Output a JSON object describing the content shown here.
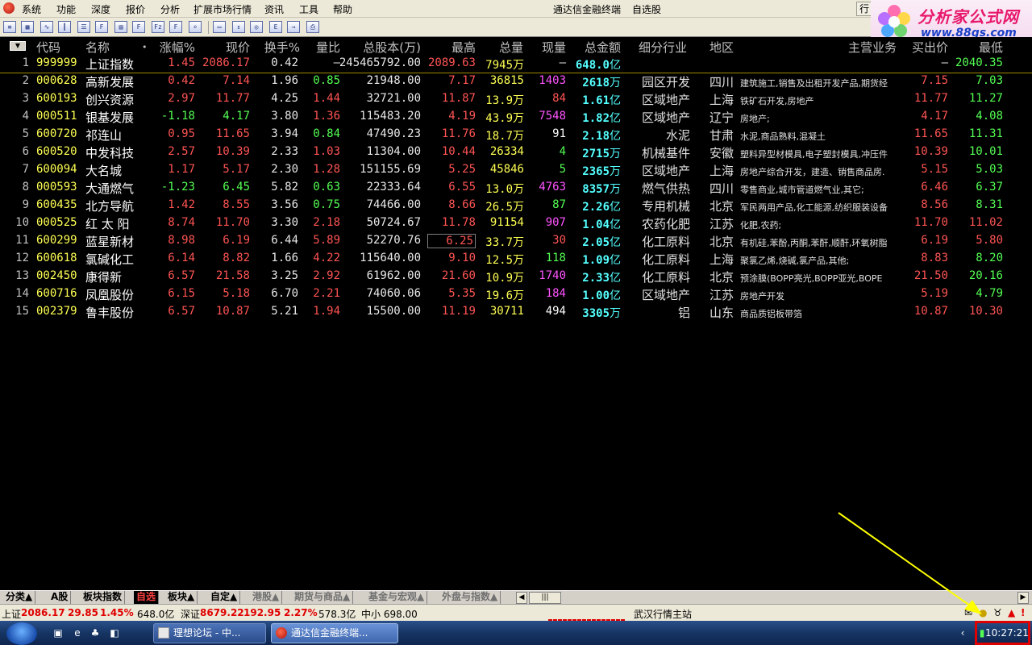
{
  "menu": {
    "items": [
      "系统",
      "功能",
      "深度",
      "报价",
      "分析",
      "扩展市场行情",
      "资讯",
      "工具",
      "帮助"
    ],
    "title": "通达信金融终端",
    "view": "自选股",
    "quote_btn": "行"
  },
  "logo": {
    "brand": "分析家公式网",
    "url": "www.88gs.com"
  },
  "toolbar": {
    "icons": [
      "list-icon",
      "grid-icon",
      "line-chart-icon",
      "candle-icon",
      "report-icon",
      "fio-icon",
      "doc-icon",
      "f10-icon",
      "fiz-icon",
      "f-icon",
      "zoom-icon",
      "folder-icon",
      "sort-icon",
      "filter-icon",
      "eft-icon",
      "export-icon",
      "print-icon"
    ]
  },
  "columns": {
    "code": "代码",
    "name": "名称",
    "dot": "•",
    "change_pct": "涨幅%",
    "price": "现价",
    "turnover": "换手%",
    "volume_ratio": "量比",
    "total_shares": "总股本(万)",
    "high": "最高",
    "total_vol": "总量",
    "cur_vol": "现量",
    "amount": "总金额",
    "industry": "细分行业",
    "region": "地区",
    "business": "主营业务",
    "bid": "买出价",
    "low": "最低"
  },
  "rows": [
    {
      "idx": "1",
      "code": "999999",
      "name": "上证指数",
      "chg": "1.45",
      "price": "2086.17",
      "turn": "0.42",
      "vr": "—",
      "shares": "245465792.00",
      "high": "2089.63",
      "vol": "7945",
      "vol_unit": "万",
      "cvol": "—",
      "amt": "648.0",
      "amt_unit": "亿",
      "ind": "",
      "area": "",
      "biz": "",
      "bid": "—",
      "low": "2040.35"
    },
    {
      "idx": "2",
      "code": "000628",
      "name": "高新发展",
      "chg": "0.42",
      "price": "7.14",
      "turn": "1.96",
      "vr": "0.85",
      "shares": "21948.00",
      "high": "7.17",
      "vol": "36815",
      "vol_unit": "",
      "cvol": "1403",
      "amt": "2618",
      "amt_unit": "万",
      "ind": "园区开发",
      "area": "四川",
      "biz": "建筑施工,销售及出租开发产品,期货经",
      "bid": "7.15",
      "low": "7.03"
    },
    {
      "idx": "3",
      "code": "600193",
      "name": "创兴资源",
      "chg": "2.97",
      "price": "11.77",
      "turn": "4.25",
      "vr": "1.44",
      "shares": "32721.00",
      "high": "11.87",
      "vol": "13.9",
      "vol_unit": "万",
      "cvol": "84",
      "amt": "1.61",
      "amt_unit": "亿",
      "ind": "区域地产",
      "area": "上海",
      "biz": "铁矿石开发,房地产",
      "bid": "11.77",
      "low": "11.27"
    },
    {
      "idx": "4",
      "code": "000511",
      "name": "银基发展",
      "chg": "-1.18",
      "price": "4.17",
      "turn": "3.80",
      "vr": "1.36",
      "shares": "115483.20",
      "high": "4.19",
      "vol": "43.9",
      "vol_unit": "万",
      "cvol": "7548",
      "amt": "1.82",
      "amt_unit": "亿",
      "ind": "区域地产",
      "area": "辽宁",
      "biz": "房地产;",
      "bid": "4.17",
      "low": "4.08"
    },
    {
      "idx": "5",
      "code": "600720",
      "name": "祁连山",
      "chg": "0.95",
      "price": "11.65",
      "turn": "3.94",
      "vr": "0.84",
      "shares": "47490.23",
      "high": "11.76",
      "vol": "18.7",
      "vol_unit": "万",
      "cvol": "91",
      "amt": "2.18",
      "amt_unit": "亿",
      "ind": "水泥",
      "area": "甘肃",
      "biz": "水泥,商品熟料,混凝土",
      "bid": "11.65",
      "low": "11.31"
    },
    {
      "idx": "6",
      "code": "600520",
      "name": "中发科技",
      "chg": "2.57",
      "price": "10.39",
      "turn": "2.33",
      "vr": "1.03",
      "shares": "11304.00",
      "high": "10.44",
      "vol": "26334",
      "vol_unit": "",
      "cvol": "4",
      "amt": "2715",
      "amt_unit": "万",
      "ind": "机械基件",
      "area": "安徽",
      "biz": "塑料异型材模具,电子塑封模具,冲压件",
      "bid": "10.39",
      "low": "10.01"
    },
    {
      "idx": "7",
      "code": "600094",
      "name": "大名城",
      "chg": "1.17",
      "price": "5.17",
      "turn": "2.30",
      "vr": "1.28",
      "shares": "151155.69",
      "high": "5.25",
      "vol": "45846",
      "vol_unit": "",
      "cvol": "5",
      "amt": "2365",
      "amt_unit": "万",
      "ind": "区域地产",
      "area": "上海",
      "biz": "房地产综合开发，建造、销售商品房.",
      "bid": "5.15",
      "low": "5.03"
    },
    {
      "idx": "8",
      "code": "000593",
      "name": "大通燃气",
      "chg": "-1.23",
      "price": "6.45",
      "turn": "5.82",
      "vr": "0.63",
      "shares": "22333.64",
      "high": "6.55",
      "vol": "13.0",
      "vol_unit": "万",
      "cvol": "4763",
      "amt": "8357",
      "amt_unit": "万",
      "ind": "燃气供热",
      "area": "四川",
      "biz": "零售商业,城市管道燃气业,其它;",
      "bid": "6.46",
      "low": "6.37"
    },
    {
      "idx": "9",
      "code": "600435",
      "name": "北方导航",
      "chg": "1.42",
      "price": "8.55",
      "turn": "3.56",
      "vr": "0.75",
      "shares": "74466.00",
      "high": "8.66",
      "vol": "26.5",
      "vol_unit": "万",
      "cvol": "87",
      "amt": "2.26",
      "amt_unit": "亿",
      "ind": "专用机械",
      "area": "北京",
      "biz": "军民两用产品,化工能源,纺织服装设备",
      "bid": "8.56",
      "low": "8.31"
    },
    {
      "idx": "10",
      "code": "000525",
      "name": "红 太 阳",
      "chg": "8.74",
      "price": "11.70",
      "turn": "3.30",
      "vr": "2.18",
      "shares": "50724.67",
      "high": "11.78",
      "vol": "91154",
      "vol_unit": "",
      "cvol": "907",
      "amt": "1.04",
      "amt_unit": "亿",
      "ind": "农药化肥",
      "area": "江苏",
      "biz": "化肥,农药;",
      "bid": "11.70",
      "low": "11.02"
    },
    {
      "idx": "11",
      "code": "600299",
      "name": "蓝星新材",
      "chg": "8.98",
      "price": "6.19",
      "turn": "6.44",
      "vr": "5.89",
      "shares": "52270.76",
      "high": "6.25",
      "vol": "33.7",
      "vol_unit": "万",
      "cvol": "30",
      "amt": "2.05",
      "amt_unit": "亿",
      "ind": "化工原料",
      "area": "北京",
      "biz": "有机硅,苯酚,丙酮,苯酐,顺酐,环氧树脂",
      "bid": "6.19",
      "low": "5.80"
    },
    {
      "idx": "12",
      "code": "600618",
      "name": "氯碱化工",
      "chg": "6.14",
      "price": "8.82",
      "turn": "1.66",
      "vr": "4.22",
      "shares": "115640.00",
      "high": "9.10",
      "vol": "12.5",
      "vol_unit": "万",
      "cvol": "118",
      "amt": "1.09",
      "amt_unit": "亿",
      "ind": "化工原料",
      "area": "上海",
      "biz": "聚氯乙烯,烧碱,氯产品,其他;",
      "bid": "8.83",
      "low": "8.20"
    },
    {
      "idx": "13",
      "code": "002450",
      "name": "康得新",
      "chg": "6.57",
      "price": "21.58",
      "turn": "3.25",
      "vr": "2.92",
      "shares": "61962.00",
      "high": "21.60",
      "vol": "10.9",
      "vol_unit": "万",
      "cvol": "1740",
      "amt": "2.33",
      "amt_unit": "亿",
      "ind": "化工原料",
      "area": "北京",
      "biz": "预涂膜(BOPP亮光,BOPP亚光,BOPE",
      "bid": "21.50",
      "low": "20.16"
    },
    {
      "idx": "14",
      "code": "600716",
      "name": "凤凰股份",
      "chg": "6.15",
      "price": "5.18",
      "turn": "6.70",
      "vr": "2.21",
      "shares": "74060.06",
      "high": "5.35",
      "vol": "19.6",
      "vol_unit": "万",
      "cvol": "184",
      "amt": "1.00",
      "amt_unit": "亿",
      "ind": "区域地产",
      "area": "江苏",
      "biz": "房地产开发",
      "bid": "5.19",
      "low": "4.79"
    },
    {
      "idx": "15",
      "code": "002379",
      "name": "鲁丰股份",
      "chg": "6.57",
      "price": "10.87",
      "turn": "5.21",
      "vr": "1.94",
      "shares": "15500.00",
      "high": "11.19",
      "vol": "30711",
      "vol_unit": "",
      "cvol": "494",
      "amt": "3305",
      "amt_unit": "万",
      "ind": "铝",
      "area": "山东",
      "biz": "商品质铝板带箔",
      "bid": "10.87",
      "low": "10.30"
    }
  ],
  "tabs": [
    {
      "label": "分类▲",
      "state": "normal"
    },
    {
      "label": "A股",
      "state": "normal"
    },
    {
      "label": "板块指数",
      "state": "normal"
    },
    {
      "label": "自选",
      "state": "active"
    },
    {
      "label": "板块▲",
      "state": "normal"
    },
    {
      "label": "自定▲",
      "state": "normal"
    },
    {
      "label": "港股▲",
      "state": "dim"
    },
    {
      "label": "期货与商品▲",
      "state": "dim"
    },
    {
      "label": "基金与宏观▲",
      "state": "dim"
    },
    {
      "label": "外盘与指数▲",
      "state": "dim"
    }
  ],
  "status": {
    "sh_label": "上证",
    "sh_index": "2086.17",
    "sh_change": "29.85",
    "sh_pct": "1.45%",
    "sh_amount": "648.0亿",
    "sz_label": "深证",
    "sz_index": "8679.22",
    "sz_change": "192.95",
    "sz_pct": "2.27%",
    "sz_amount": "578.3亿",
    "sme": "中小 698.00",
    "server": "武汉行情主站"
  },
  "taskbar": {
    "tasks": [
      {
        "label": "理想论坛 - 中...",
        "active": false
      },
      {
        "label": "通达信金融终端...",
        "active": true
      }
    ],
    "clock": "10:27:21"
  },
  "colors": {
    "up": "#ff5454",
    "down": "#54ff54",
    "code": "#ffff54",
    "amount": "#54ffff",
    "cur_vol_up": "#ff54ff",
    "background": "#000000"
  }
}
